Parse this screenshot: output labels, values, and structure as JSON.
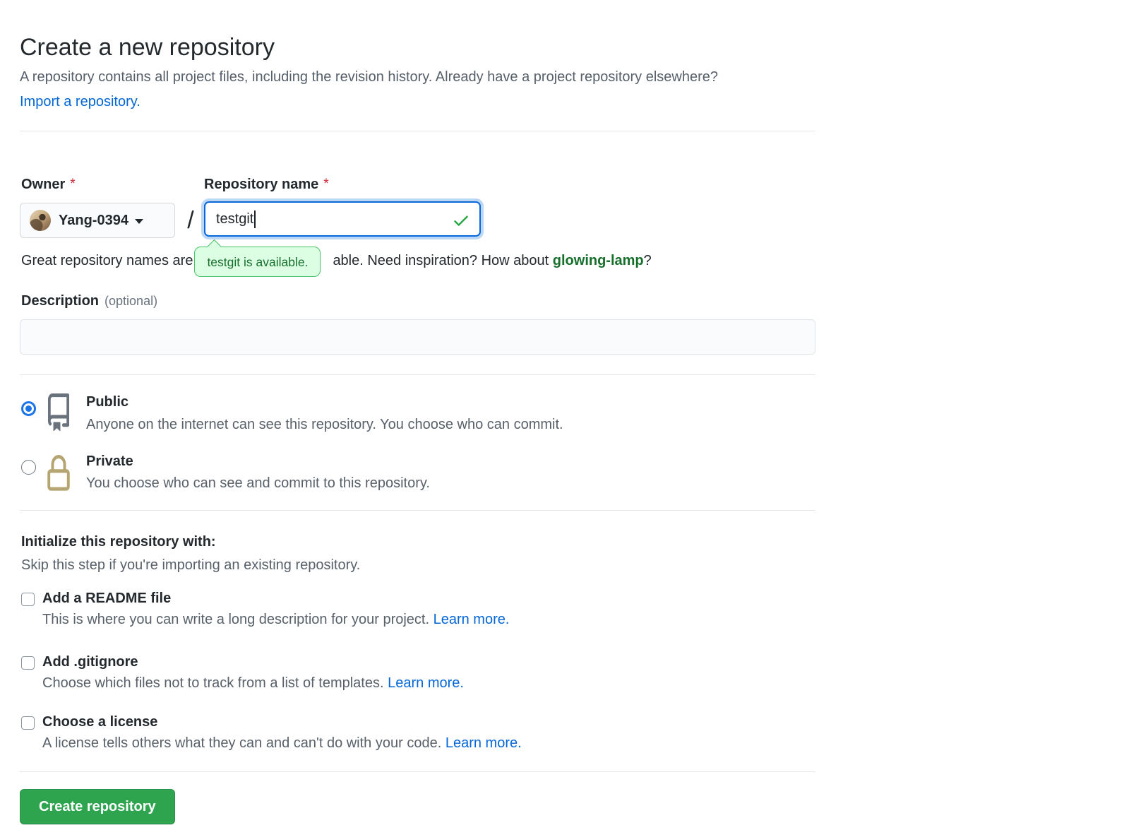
{
  "header": {
    "title": "Create a new repository",
    "subtitle": "A repository contains all project files, including the revision history. Already have a project repository elsewhere?",
    "import_link": "Import a repository."
  },
  "form": {
    "owner": {
      "label": "Owner",
      "required": "*",
      "value": "Yang-0394"
    },
    "separator": "/",
    "repository_name": {
      "label": "Repository name",
      "required": "*",
      "value": "testgit",
      "availability_tooltip": "testgit is available."
    },
    "name_hint": {
      "prefix": "Great repository names are",
      "suffix": "able. Need inspiration? How about",
      "suggestion": "glowing-lamp",
      "end": "?"
    },
    "description": {
      "label": "Description",
      "optional": "(optional)",
      "value": ""
    },
    "visibility": {
      "public": {
        "label": "Public",
        "description": "Anyone on the internet can see this repository. You choose who can commit.",
        "selected": true
      },
      "private": {
        "label": "Private",
        "description": "You choose who can see and commit to this repository.",
        "selected": false
      }
    },
    "initialize": {
      "heading": "Initialize this repository with:",
      "note": "Skip this step if you're importing an existing repository.",
      "options": [
        {
          "label": "Add a README file",
          "description": "This is where you can write a long description for your project.",
          "link": "Learn more.",
          "checked": false
        },
        {
          "label": "Add .gitignore",
          "description": "Choose which files not to track from a list of templates.",
          "link": "Learn more.",
          "checked": false
        },
        {
          "label": "Choose a license",
          "description": "A license tells others what they can and can't do with your code.",
          "link": "Learn more.",
          "checked": false
        }
      ]
    }
  },
  "actions": {
    "create_button": "Create repository"
  },
  "colors": {
    "accent_green": "#2ea44f",
    "link_blue": "#0366d6",
    "success_green": "#28a745",
    "tooltip_bg": "#dcffe4",
    "tooltip_border": "#4ac26b",
    "focus_blue": "#0969da",
    "required_red": "#cb2431",
    "lock_tan": "#b5a572",
    "icon_gray": "#6a737d"
  }
}
